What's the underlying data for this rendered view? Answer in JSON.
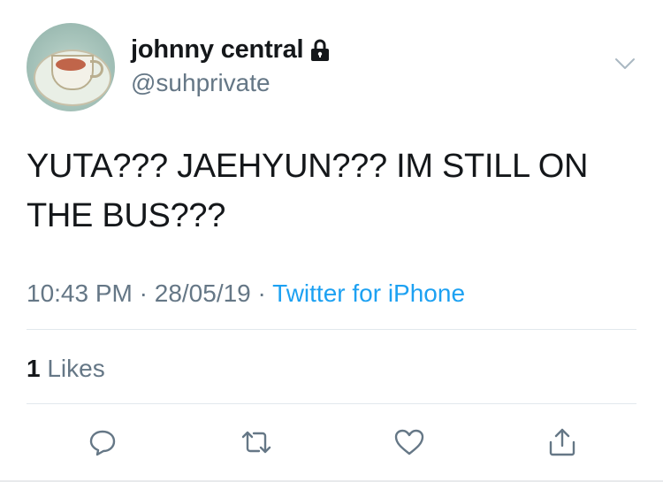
{
  "user": {
    "display_name": "johnny central",
    "handle": "@suhprivate",
    "protected_icon": "lock-icon",
    "avatar": "teacup-avatar"
  },
  "menu_icon": "chevron-down-icon",
  "tweet": {
    "text": "YUTA??? JAEHYUN??? IM STILL ON THE BUS???",
    "time": "10:43 PM",
    "separator": "·",
    "date": "28/05/19",
    "source": "Twitter for iPhone"
  },
  "stats": {
    "likes_count": "1",
    "likes_label": "Likes"
  },
  "actions": [
    {
      "name": "reply-icon"
    },
    {
      "name": "retweet-icon"
    },
    {
      "name": "like-icon"
    },
    {
      "name": "share-icon"
    }
  ],
  "colors": {
    "text": "#14171a",
    "secondary": "#657786",
    "link": "#1da1f2",
    "divider": "#e1e8ed"
  }
}
